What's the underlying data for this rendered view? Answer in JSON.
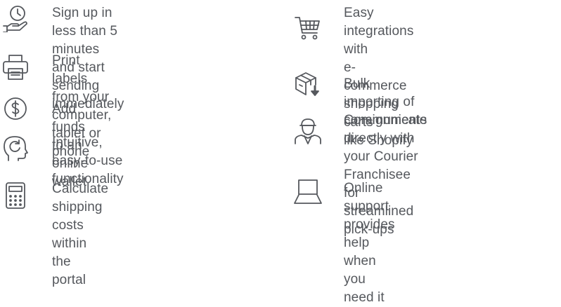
{
  "features_left": [
    {
      "icon": "clock-hand-icon",
      "text": "Sign up in less than 5 minutes\nand start sending immediately"
    },
    {
      "icon": "printer-icon",
      "text": "Print labels from your computer,\ntablet or phone"
    },
    {
      "icon": "dollar-coin-icon",
      "text": "Add funds to an online wallet"
    },
    {
      "icon": "head-refresh-icon",
      "text": "Intuitive, easy-to-use\nfunctionality"
    },
    {
      "icon": "calculator-icon",
      "text": "Calculate shipping costs\nwithin the portal"
    }
  ],
  "features_right": [
    {
      "icon": "shopping-cart-icon",
      "text": "Easy integrations with\ne-commerce shopping carts\nlike Shopify"
    },
    {
      "icon": "package-download-icon",
      "text": "Bulk importing of consignments"
    },
    {
      "icon": "courier-person-icon",
      "text": "Communicate directly with\nyour Courier Franchisee for\nstreamlined pick-ups"
    },
    {
      "icon": "laptop-icon",
      "text": "Online support provides help\nwhen you need it"
    }
  ],
  "colors": {
    "icon_stroke": "#55585d",
    "text": "#55585d",
    "background": "#ffffff"
  }
}
